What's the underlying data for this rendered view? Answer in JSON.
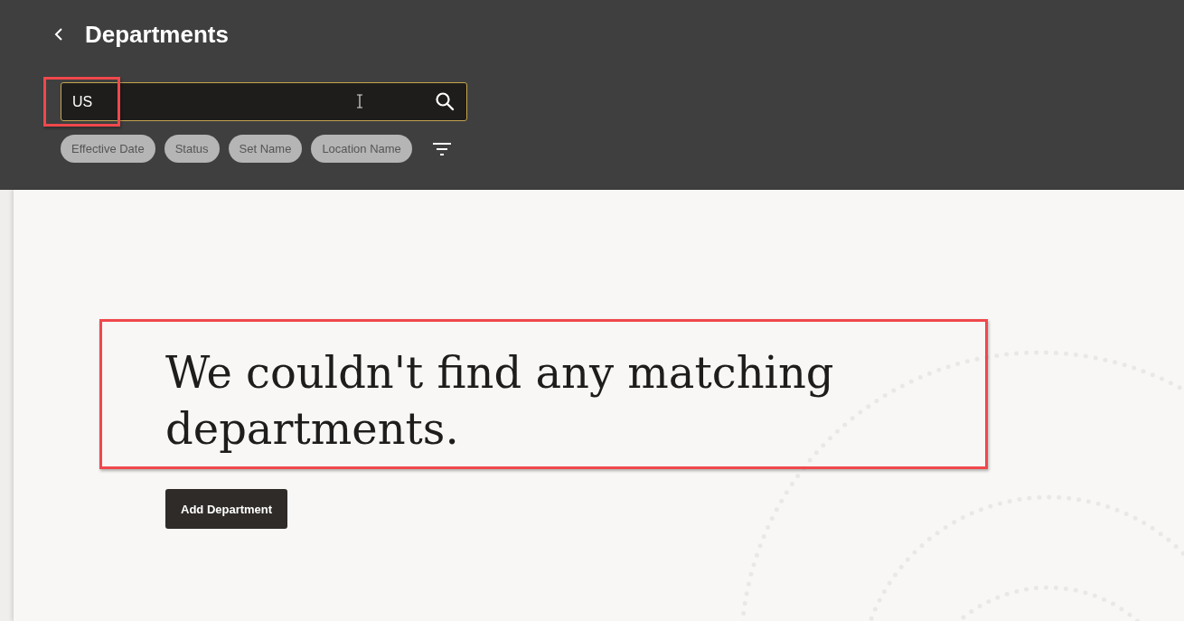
{
  "header": {
    "title": "Departments"
  },
  "search": {
    "value": "US"
  },
  "filter_chips": [
    {
      "label": "Effective Date"
    },
    {
      "label": "Status"
    },
    {
      "label": "Set Name"
    },
    {
      "label": "Location Name"
    }
  ],
  "empty_state": {
    "message": "We couldn't find any matching departments.",
    "button": "Add Department"
  }
}
